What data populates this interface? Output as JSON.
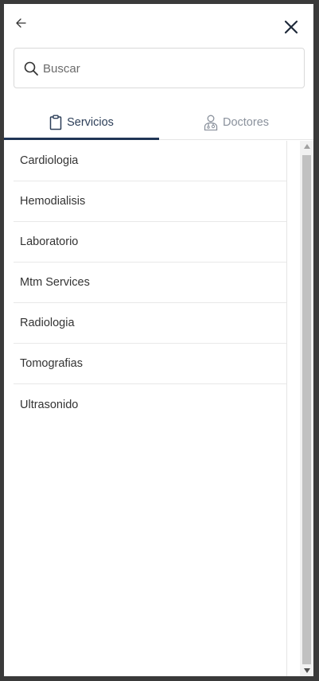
{
  "header": {
    "back_icon": "arrow-left-icon",
    "close_icon": "close-icon"
  },
  "search": {
    "placeholder": "Buscar",
    "value": "",
    "icon": "search-icon"
  },
  "tabs": [
    {
      "label": "Servicios",
      "icon": "clipboard-icon",
      "active": true
    },
    {
      "label": "Doctores",
      "icon": "doctor-icon",
      "active": false
    }
  ],
  "services": [
    {
      "label": "Cardiologia"
    },
    {
      "label": "Hemodialisis"
    },
    {
      "label": "Laboratorio"
    },
    {
      "label": "Mtm Services"
    },
    {
      "label": "Radiologia"
    },
    {
      "label": "Tomografias"
    },
    {
      "label": "Ultrasonido"
    }
  ],
  "colors": {
    "accent": "#1f3556",
    "active_tab_text": "#2c3e58",
    "inactive_tab_text": "#8a919c",
    "frame": "#3a3a3a"
  }
}
